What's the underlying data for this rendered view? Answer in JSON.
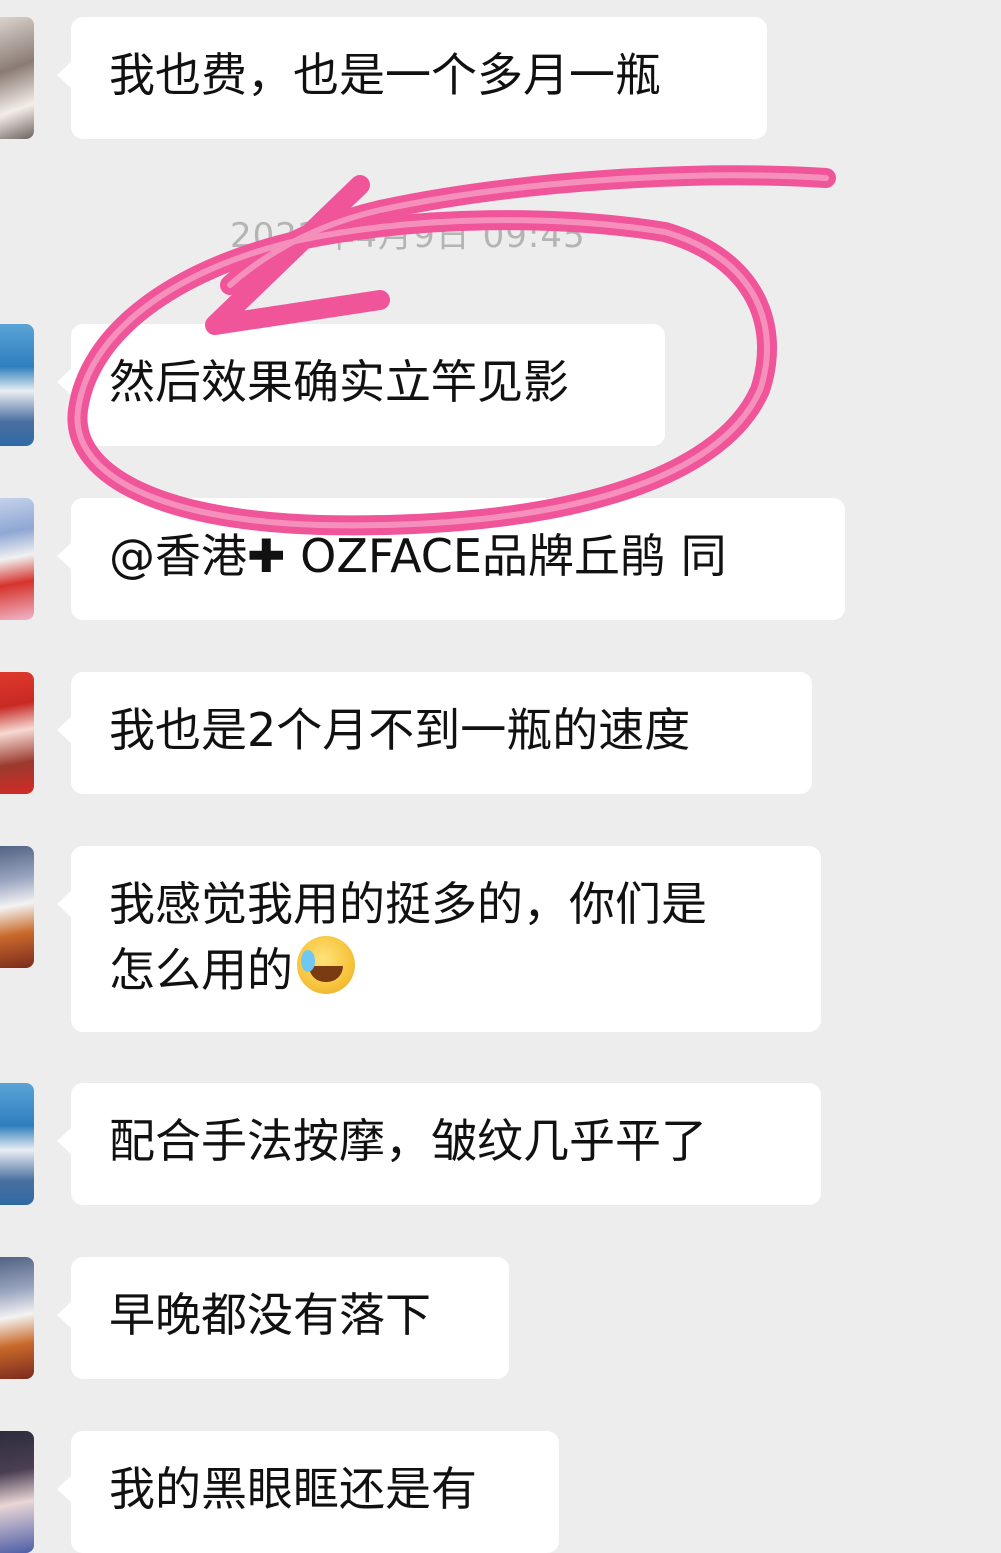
{
  "timestamp": "2022年4月9日 09:45",
  "messages": [
    {
      "id": "m1",
      "text": "我也费，也是一个多月一瓶",
      "avatar_colors": [
        "#d9d3cf",
        "#5b4f49",
        "#f2ece8"
      ]
    },
    {
      "id": "m2",
      "text": "然后效果确实立竿见影",
      "avatar_colors": [
        "#3b8ec9",
        "#f2f2f2",
        "#6a4b3c"
      ]
    },
    {
      "id": "m3",
      "text": "@香港✚ OZFACE品牌丘鹃 同",
      "avatar_colors": [
        "#b7c8e8",
        "#d6332c",
        "#f4f4f4"
      ]
    },
    {
      "id": "m4",
      "text": "我也是2个月不到一瓶的速度",
      "avatar_colors": [
        "#d42a25",
        "#f6d2cc",
        "#8a3b2f"
      ]
    },
    {
      "id": "m5",
      "text_line1": "我感觉我用的挺多的，你们是",
      "text_line2": "怎么用的",
      "avatar_colors": [
        "#3a4b6d",
        "#f2f2f2",
        "#c96a2b"
      ]
    },
    {
      "id": "m6",
      "text": "配合手法按摩，皱纹几乎平了",
      "avatar_colors": [
        "#3b8ec9",
        "#f2f2f2",
        "#6a4b3c"
      ]
    },
    {
      "id": "m7",
      "text": "早晚都没有落下",
      "avatar_colors": [
        "#3a4b6d",
        "#f2f2f2",
        "#c96a2b"
      ]
    },
    {
      "id": "m8",
      "text": "我的黑眼眶还是有",
      "avatar_colors": [
        "#2b2a3a",
        "#e9d6d7",
        "#4c5da6"
      ]
    }
  ],
  "annotation": {
    "color": "#f0559a",
    "description_icon": "hand-drawn-circle-arrow"
  },
  "emoji_icon": "tears-of-joy-emoji"
}
